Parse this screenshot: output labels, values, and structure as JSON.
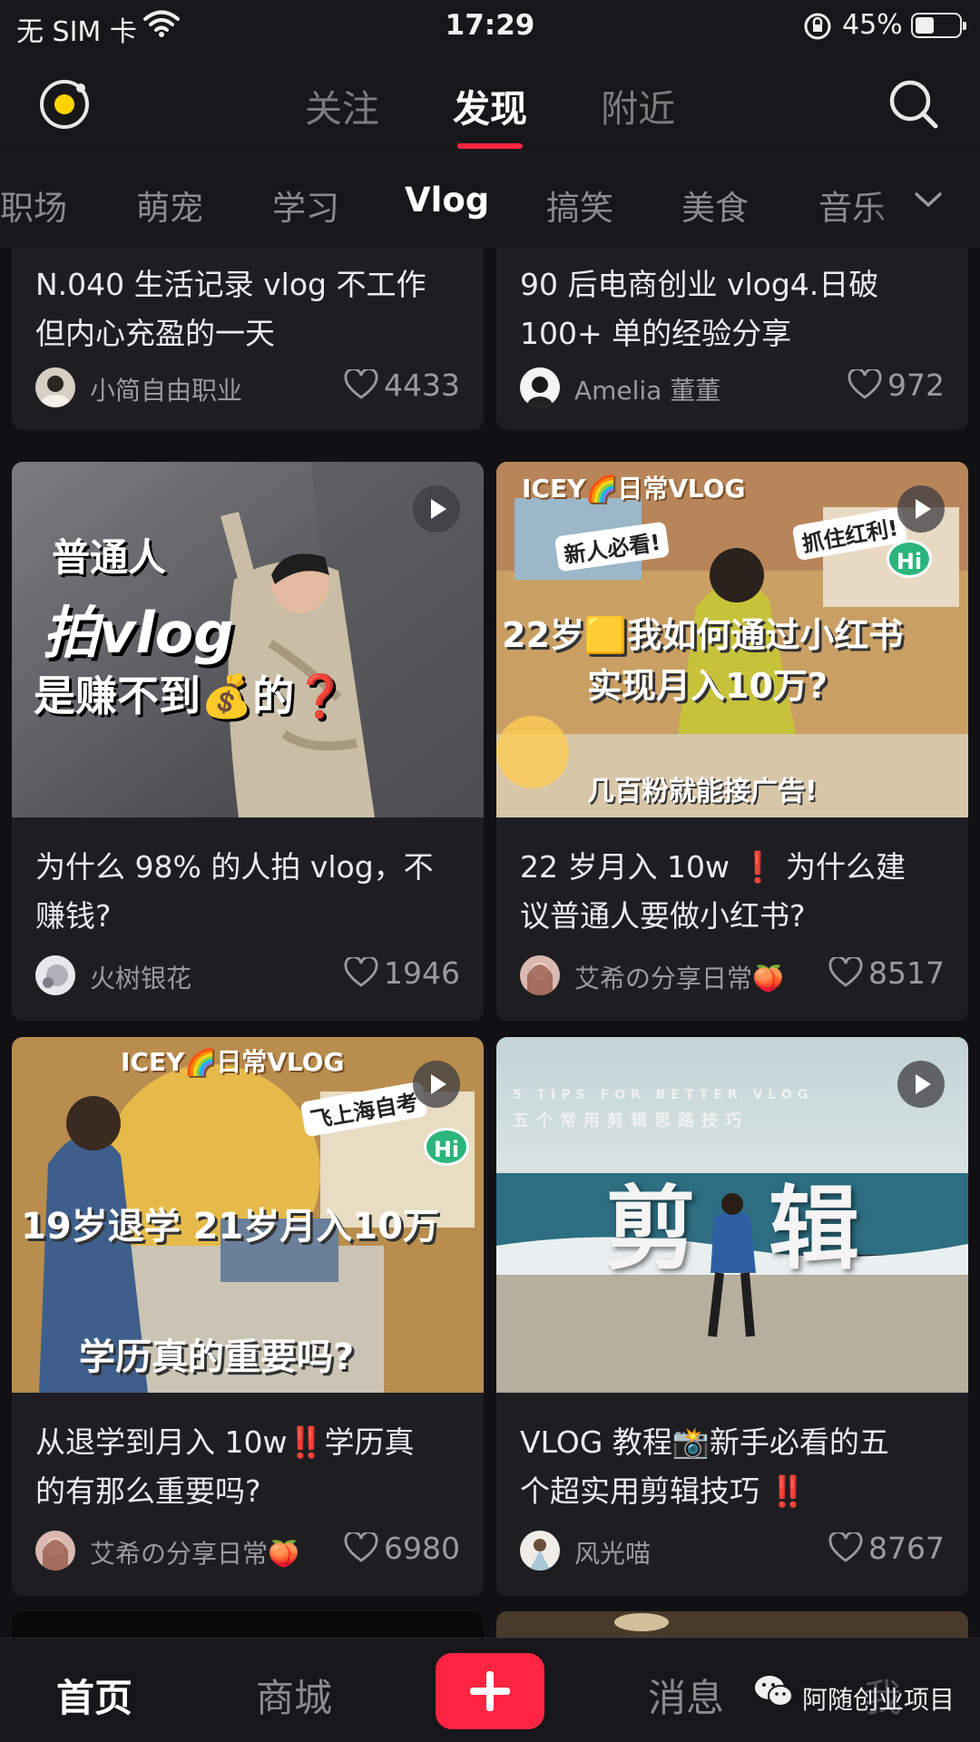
{
  "status_bar": {
    "carrier": "无 SIM 卡",
    "time": "17:29",
    "battery_percent": "45%"
  },
  "top_nav": {
    "tabs": [
      "关注",
      "发现",
      "附近"
    ],
    "active_tab": "发现"
  },
  "categories": {
    "items": [
      "职场",
      "萌宠",
      "学习",
      "Vlog",
      "搞笑",
      "美食",
      "音乐"
    ],
    "active": "Vlog"
  },
  "feed": {
    "cards": [
      {
        "title_line1": "N.040 生活记录 vlog 不工作",
        "title_line2": "但内心充盈的一天",
        "author": "小简自由职业",
        "likes": "4433"
      },
      {
        "title_line1": "90 后电商创业 vlog4.日破",
        "title_line2": "100+ 单的经验分享",
        "author": "Amelia 董董",
        "likes": "972"
      },
      {
        "title_line1": "为什么 98% 的人拍 vlog，不",
        "title_line2": "赚钱?",
        "author": "火树银花",
        "likes": "1946",
        "overlay": {
          "line1": "普通人",
          "line2": "拍vlog",
          "line3": "是赚不到💰的❓"
        }
      },
      {
        "title_line1": "22 岁月入 10w ❗ 为什么建",
        "title_line2": "议普通人要做小红书?",
        "author": "艾希の分享日常🍑",
        "likes": "8517",
        "overlay": {
          "brand": "ICEY🌈日常VLOG",
          "tag_left": "新人必看!",
          "tag_right": "抓住红利!",
          "hi": "Hi",
          "line1": "22岁🟨我如何通过小红书",
          "line2": "实现月入10万?",
          "bottom": "几百粉就能接广告!"
        }
      },
      {
        "title_line1": "从退学到月入 10w‼️学历真",
        "title_line2": "的有那么重要吗?",
        "author": "艾希の分享日常🍑",
        "likes": "6980",
        "overlay": {
          "brand": "ICEY🌈日常VLOG",
          "tag_right": "飞上海自考",
          "hi": "Hi",
          "line1": "19岁退学 21岁月入10万",
          "bottom": "学历真的重要吗?"
        }
      },
      {
        "title_line1": "VLOG 教程📸新手必看的五",
        "title_line2": "个超实用剪辑技巧 ‼️",
        "author": "风光喵",
        "likes": "8767",
        "overlay": {
          "subtitle_en": "5 TIPS FOR BETTER VLOG",
          "subtitle_cn": "五个常用剪辑思路技巧",
          "big1": "剪",
          "big2": "辑"
        }
      }
    ]
  },
  "bottom_nav": {
    "home": "首页",
    "mall": "商城",
    "messages": "消息",
    "me": "我"
  },
  "watermark": {
    "text": "阿随创业项目"
  },
  "colors": {
    "accent": "#ff2442",
    "background": "#111114",
    "card": "#1e1e22"
  },
  "icons": [
    "wifi-icon",
    "rotation-lock-icon",
    "battery-icon",
    "logo-icon",
    "search-icon",
    "chevron-down-icon",
    "heart-icon",
    "play-icon",
    "plus-icon",
    "wechat-icon"
  ]
}
